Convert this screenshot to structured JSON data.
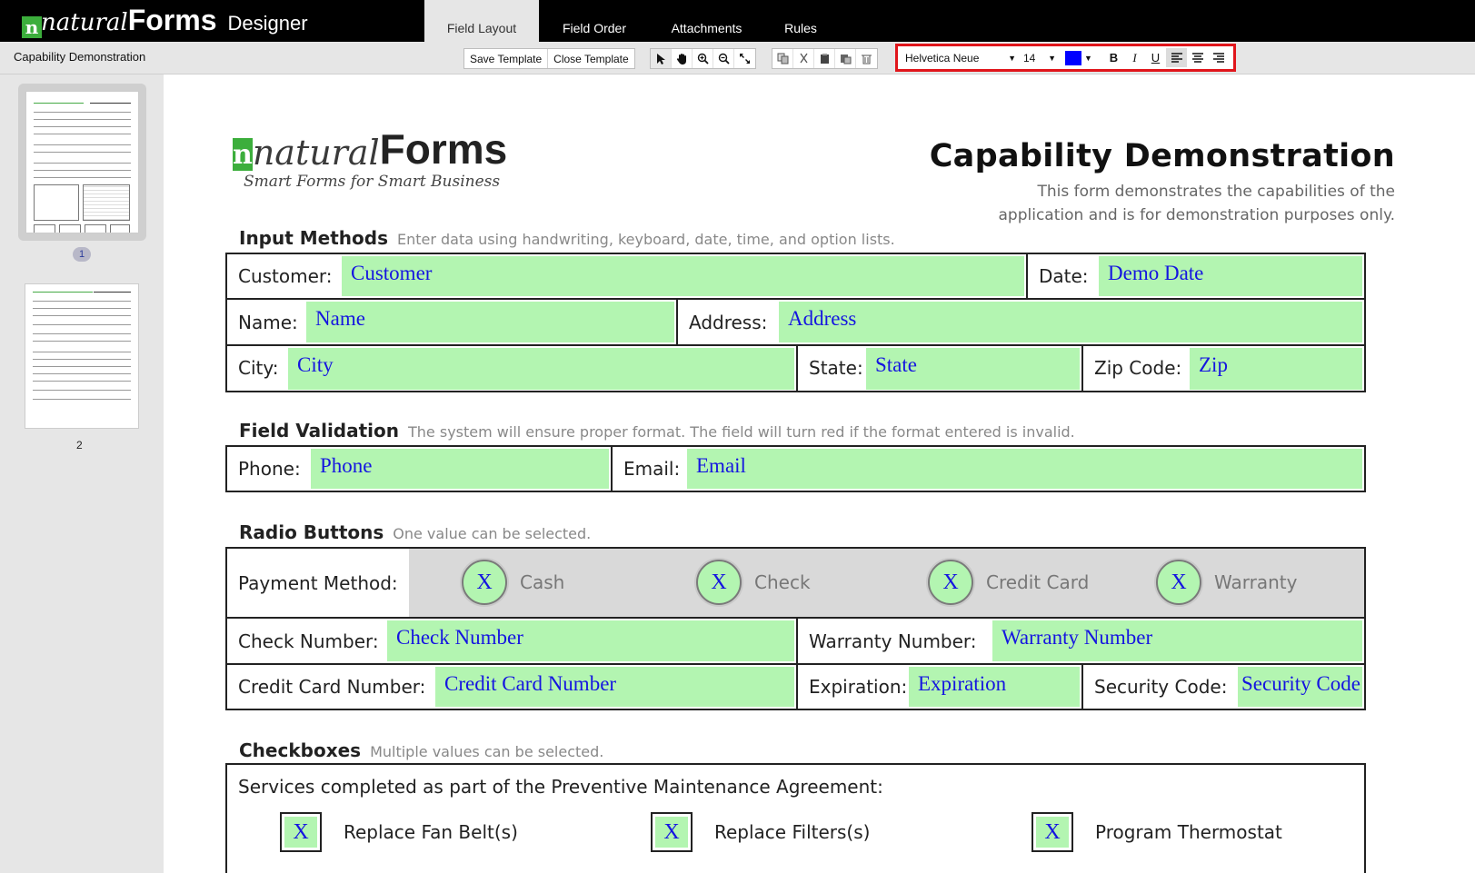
{
  "app": {
    "logo_natural": "natural",
    "logo_forms": "Forms",
    "logo_designer": "Designer",
    "tabs": [
      {
        "label": "Field Layout",
        "active": true
      },
      {
        "label": "Field Order"
      },
      {
        "label": "Attachments"
      },
      {
        "label": "Rules"
      }
    ]
  },
  "toolbar": {
    "doc_title": "Capability Demonstration",
    "save_template": "Save Template",
    "close_template": "Close Template",
    "tool_icons": [
      "pointer-icon",
      "hand-icon",
      "zoom-in-icon",
      "zoom-out-icon",
      "fit-icon"
    ],
    "edit_icons": [
      "copy-icon",
      "cut-icon",
      "paste-icon",
      "paste-format-icon",
      "delete-icon"
    ],
    "font": "Helvetica Neue",
    "size": "14",
    "color": "#0000ff",
    "bold": "B",
    "italic": "I",
    "underline": "U"
  },
  "sidebar": {
    "pages": [
      {
        "number": "1",
        "selected": true
      },
      {
        "number": "2"
      }
    ]
  },
  "form": {
    "logo_main": "Forms",
    "logo_natural": "natural",
    "logo_n": "n",
    "logo_tagline": "Smart Forms for Smart Business",
    "title": "Capability Demonstration",
    "subtitle": "This form demonstrates the capabilities of the application and is for demonstration purposes only.",
    "sections": {
      "input": {
        "title": "Input Methods",
        "hint": "Enter data using handwriting, keyboard, date, time, and option lists."
      },
      "validation": {
        "title": "Field Validation",
        "hint": "The system will ensure proper format. The field will turn red if the format entered is invalid."
      },
      "radio": {
        "title": "Radio Buttons",
        "hint": "One value can be selected."
      },
      "checkboxes": {
        "title": "Checkboxes",
        "hint": "Multiple values can be selected."
      }
    },
    "fields": {
      "customer": {
        "label": "Customer:",
        "value": "Customer"
      },
      "date": {
        "label": "Date:",
        "value": "Demo Date"
      },
      "name": {
        "label": "Name:",
        "value": "Name"
      },
      "address": {
        "label": "Address:",
        "value": "Address"
      },
      "city": {
        "label": "City:",
        "value": "City"
      },
      "state": {
        "label": "State:",
        "value": "State"
      },
      "zip": {
        "label": "Zip Code:",
        "value": "Zip"
      },
      "phone": {
        "label": "Phone:",
        "value": "Phone"
      },
      "email": {
        "label": "Email:",
        "value": "Email"
      },
      "check_number": {
        "label": "Check Number:",
        "value": "Check Number"
      },
      "warranty_number": {
        "label": "Warranty Number:",
        "value": "Warranty Number"
      },
      "credit_card": {
        "label": "Credit Card Number:",
        "value": "Credit Card Number"
      },
      "expiration": {
        "label": "Expiration:",
        "value": "Expiration"
      },
      "security_code": {
        "label": "Security Code:",
        "value": "Security Code"
      }
    },
    "payment": {
      "label": "Payment Method:",
      "mark": "X",
      "options": [
        "Cash",
        "Check",
        "Credit Card",
        "Warranty"
      ]
    },
    "services": {
      "label": "Services completed as part of the Preventive Maintenance Agreement:",
      "mark": "X",
      "options": [
        "Replace Fan Belt(s)",
        "Replace Filters(s)",
        "Program Thermostat"
      ]
    }
  }
}
